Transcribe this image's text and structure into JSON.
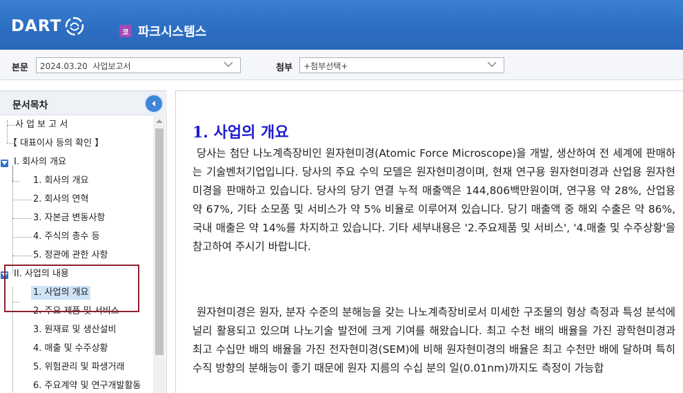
{
  "header": {
    "logo": "DART",
    "company_badge": "코",
    "company_name": "파크시스템스"
  },
  "toolbar": {
    "body_label": "본문",
    "body_select_value": "2024.03.20  사업보고서",
    "attach_label": "첨부",
    "attach_select_value": "+첨부선택+"
  },
  "toc": {
    "title": "문서목차",
    "items": [
      {
        "label": "사 업 보 고 서"
      },
      {
        "label": "【 대표이사 등의 확인 】"
      },
      {
        "label": "I. 회사의 개요"
      },
      {
        "label": "1. 회사의 개요"
      },
      {
        "label": "2. 회사의 연혁"
      },
      {
        "label": "3. 자본금 변동사항"
      },
      {
        "label": "4. 주식의 총수 등"
      },
      {
        "label": "5. 정관에 관한 사항"
      },
      {
        "label": "II. 사업의 내용"
      },
      {
        "label": "1. 사업의 개요"
      },
      {
        "label": "2. 주요 제품 및 서비스"
      },
      {
        "label": "3. 원재료 및 생산설비"
      },
      {
        "label": "4. 매출 및 수주상황"
      },
      {
        "label": "5. 위험관리 및 파생거래"
      },
      {
        "label": "6. 주요계약 및 연구개발활동"
      }
    ]
  },
  "content": {
    "title": "1. 사업의 개요",
    "paragraphs": [
      "당사는 첨단 나노계측장비인 원자현미경(Atomic Force Microscope)을 개발, 생산하여 전 세계에 판매하는 기술벤처기업입니다. 당사의 주요 수익 모델은 원자현미경이며, 현재 연구용 원자현미경과 산업용 원자현미경을 판매하고 있습니다. 당사의 당기 연결 누적 매출액은 144,806백만원이며, 연구용 약 28%, 산업용 약 67%, 기타 소모품 및 서비스가 약 5% 비율로 이루어져 있습니다. 당기 매출액 중 해외 수출은 약 86%, 국내 매출은 약 14%를 차지하고 있습니다. 기타 세부내용은 '2.주요제품 및 서비스', '4.매출 및 수주상황'을 참고하여 주시기 바랍니다.",
      "원자현미경은 원자, 분자 수준의 분해능을 갖는 나노계측장비로서 미세한 구조물의 형상 측정과 특성 분석에 널리 활용되고 있으며 나노기술 발전에 크게 기여를 해왔습니다. 최고 수천 배의 배율을 가진 광학현미경과 최고 수십만 배의 배율을 가진 전자현미경(SEM)에 비해 원자현미경의 배율은 최고 수천만 배에 달하며 특히 수직 방향의 분해능이 좋기 때문에 원자 지름의 수십 분의 일(0.01nm)까지도 측정이 가능합"
    ]
  }
}
